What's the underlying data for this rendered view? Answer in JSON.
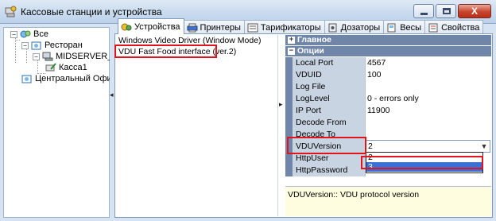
{
  "window": {
    "title": "Кассовые станции и устройства",
    "close_label": "X"
  },
  "tree": {
    "items": [
      {
        "label": "Все",
        "expander": "−"
      },
      {
        "label": "Ресторан",
        "expander": "−"
      },
      {
        "label": "MIDSERVER_TNG",
        "expander": "−"
      },
      {
        "label": "Касса1",
        "expander": ""
      },
      {
        "label": "Центральный Офис",
        "expander": ""
      }
    ]
  },
  "tabs": [
    {
      "label": "Устройства",
      "icon": "devices-icon"
    },
    {
      "label": "Принтеры",
      "icon": "printer-icon"
    },
    {
      "label": "Тарификаторы",
      "icon": "tariff-icon"
    },
    {
      "label": "Дозаторы",
      "icon": "dispenser-icon"
    },
    {
      "label": "Весы",
      "icon": "scales-icon"
    },
    {
      "label": "Свойства",
      "icon": "properties-icon"
    }
  ],
  "devices": [
    {
      "label": "Windows Video Driver (Window Mode)"
    },
    {
      "label": "VDU Fast Food interface (ver.2)"
    }
  ],
  "properties": {
    "categories": [
      {
        "label": "Главное",
        "expander": "+"
      },
      {
        "label": "Опции",
        "expander": "−"
      }
    ],
    "rows": [
      {
        "name": "Local Port",
        "value": "4567"
      },
      {
        "name": "VDUID",
        "value": "100"
      },
      {
        "name": "Log File",
        "value": ""
      },
      {
        "name": "LogLevel",
        "value": "0 - errors only"
      },
      {
        "name": "IP Port",
        "value": "11900"
      },
      {
        "name": "Decode From",
        "value": ""
      },
      {
        "name": "Decode To",
        "value": ""
      },
      {
        "name": "VDUVersion",
        "value": "2"
      },
      {
        "name": "HttpUser",
        "value": ""
      },
      {
        "name": "HttpPassword",
        "value": ""
      }
    ],
    "dropdown_options": [
      "2",
      "3"
    ],
    "selected_option": "3",
    "description": "VDUVersion:: VDU protocol version"
  },
  "colors": {
    "highlight_red": "#e0141c",
    "category_bg": "#6f86a8",
    "selection_blue": "#3a6fd6",
    "description_bg": "#fffde0"
  }
}
